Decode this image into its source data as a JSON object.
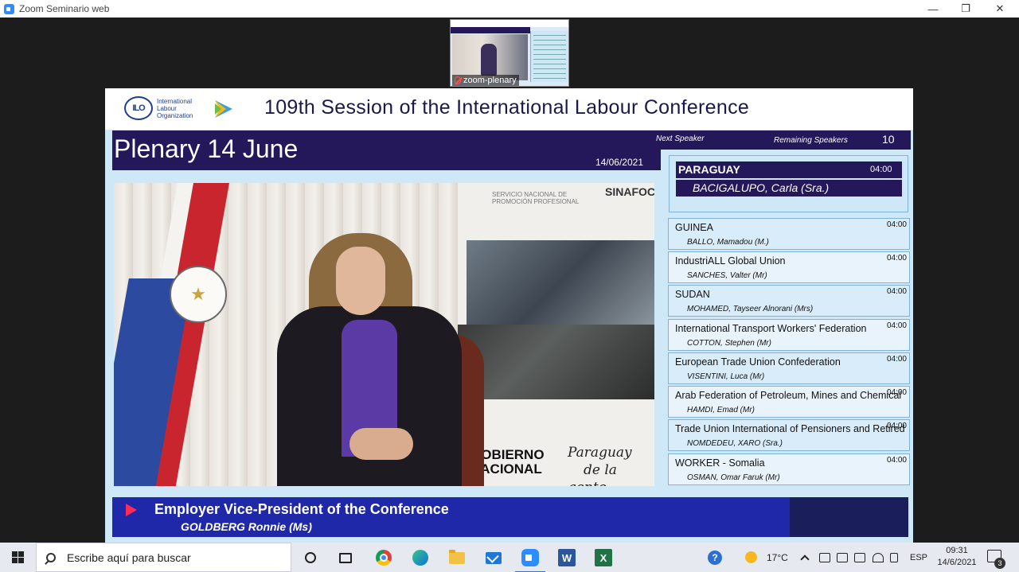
{
  "window": {
    "title": "Zoom Seminario web",
    "minimize_icon": "—",
    "restore_icon": "❐",
    "close_icon": "✕"
  },
  "thumbnail": {
    "label": "zoom-plenary"
  },
  "slide": {
    "org_logo": "ILO",
    "org_lines": [
      "International",
      "Labour",
      "Organization"
    ],
    "conference_title": "109th Session of the International Labour Conference",
    "plenary_title": "Plenary 14 June",
    "date": "14/06/2021",
    "next_speaker_label": "Next Speaker",
    "remaining_label": "Remaining Speakers",
    "remaining_count": "10",
    "next": {
      "country": "PARAGUAY",
      "time": "04:00",
      "name": "BACIGALUPO, Carla (Sra.)"
    },
    "video_backdrop": {
      "header": "SERVICIO NACIONAL DE PROMOCIÓN PROFESIONAL",
      "logo": "SINAFOC",
      "gov_line1": "GOBIERNO",
      "gov_line2": "NACIONAL",
      "slogan_line1": "Paraguay",
      "slogan_line2": "de la gente"
    },
    "speakers": [
      {
        "country": "GUINEA",
        "time": "04:00",
        "name": "BALLO, Mamadou (M.)"
      },
      {
        "country": "IndustriALL Global Union",
        "time": "04:00",
        "name": "SANCHES, Valter (Mr)"
      },
      {
        "country": "SUDAN",
        "time": "04:00",
        "name": "MOHAMED, Tayseer Alnorani (Mrs)"
      },
      {
        "country": "International Transport Workers' Federation",
        "time": "04:00",
        "name": "COTTON, Stephen (Mr)"
      },
      {
        "country": "European Trade Union Confederation",
        "time": "04:00",
        "name": "VISENTINI, Luca (Mr)"
      },
      {
        "country": "Arab Federation of Petroleum, Mines and Chemical",
        "time": "04:00",
        "name": "HAMDI, Emad (Mr)"
      },
      {
        "country": "Trade Union International of Pensioners and Retired",
        "time": "04:00",
        "name": "NOMDEDEU, XARO (Sra.)"
      },
      {
        "country": "WORKER  -  Somalia",
        "time": "04:00",
        "name": "OSMAN, Omar Faruk (Mr)"
      }
    ],
    "current": {
      "role": "Employer Vice-President of the Conference",
      "name": "GOLDBERG Ronnie (Ms)"
    }
  },
  "taskbar": {
    "search_placeholder": "Escribe aquí para buscar",
    "word_letter": "W",
    "excel_letter": "X",
    "help_letter": "?",
    "temperature": "17°C",
    "language": "ESP",
    "time": "09:31",
    "date": "14/6/2021",
    "notification_count": "3"
  },
  "icons": [
    "windows-start-icon",
    "search-icon",
    "cortana-icon",
    "task-view-icon",
    "chrome-icon",
    "edge-icon",
    "file-explorer-icon",
    "mail-icon",
    "zoom-icon",
    "word-icon",
    "excel-icon",
    "help-icon",
    "weather-icon",
    "network-icon",
    "volume-icon",
    "notification-icon",
    "play-icon",
    "mic-muted-icon"
  ]
}
